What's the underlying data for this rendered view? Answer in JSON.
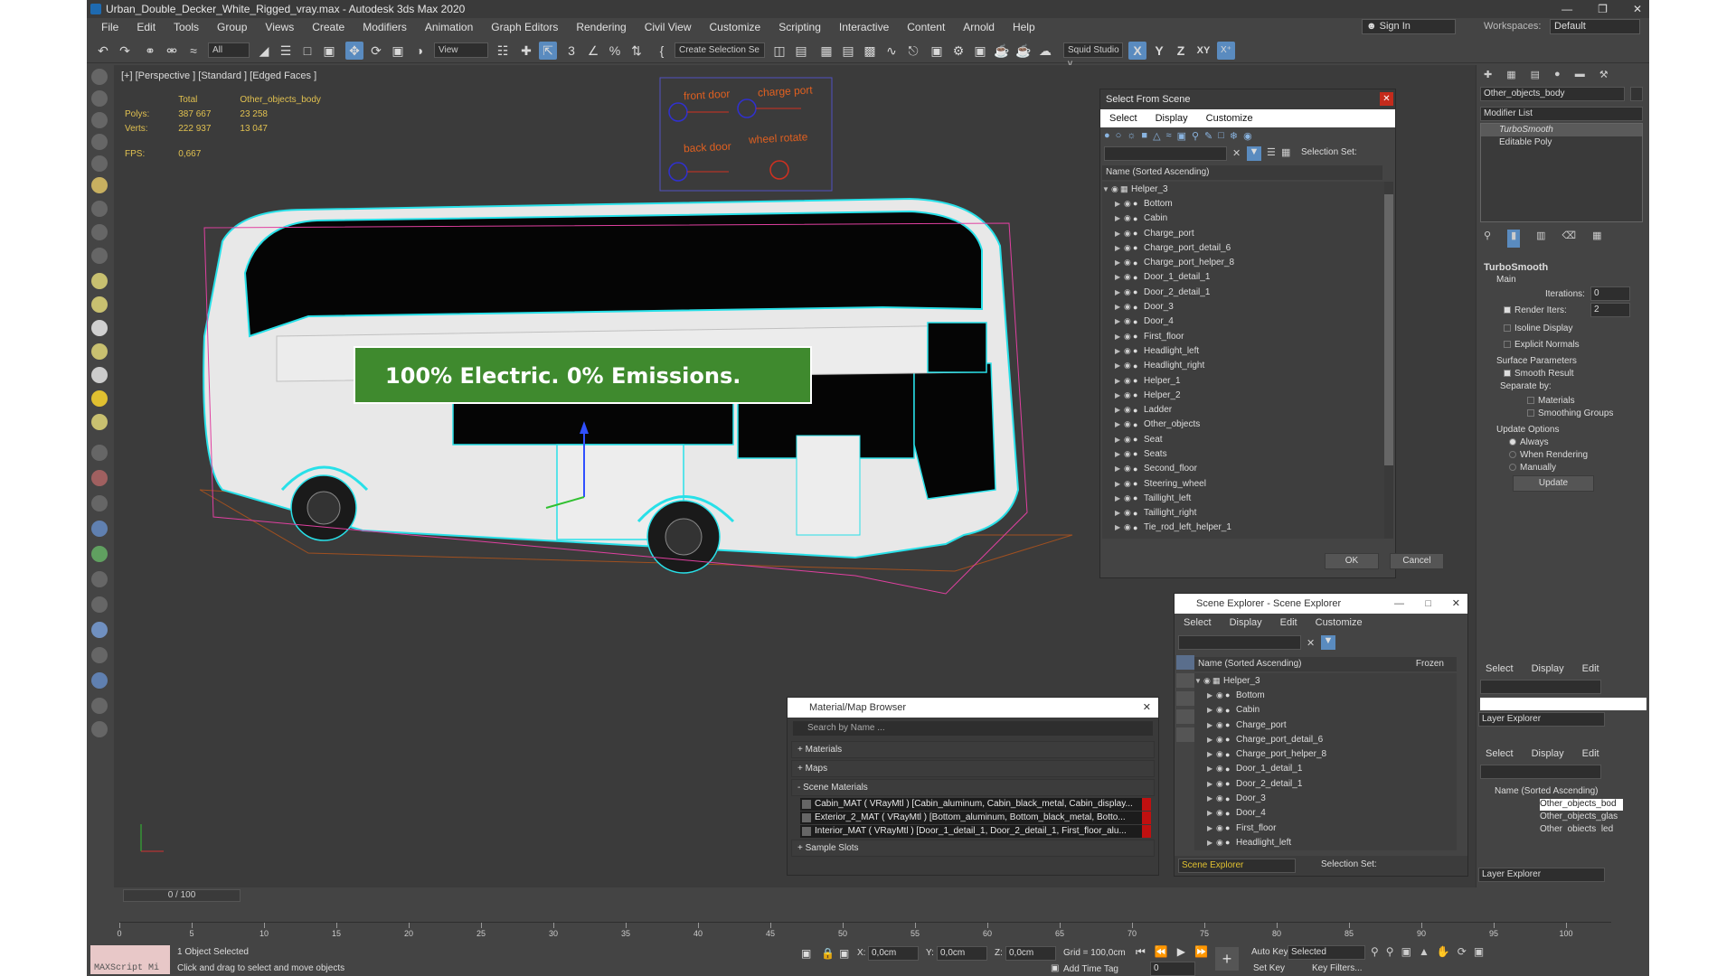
{
  "window": {
    "title": "Urban_Double_Decker_White_Rigged_vray.max - Autodesk 3ds Max 2020"
  },
  "menu": [
    "File",
    "Edit",
    "Tools",
    "Group",
    "Views",
    "Create",
    "Modifiers",
    "Animation",
    "Graph Editors",
    "Rendering",
    "Civil View",
    "Customize",
    "Scripting",
    "Interactive",
    "Content",
    "Arnold",
    "Help"
  ],
  "account": {
    "sign_in": "Sign In",
    "workspaces_label": "Workspaces:",
    "workspace": "Default"
  },
  "toolbar": {
    "filter": "All",
    "view": "View",
    "create_selection": "Create Selection Se",
    "squid": "Squid Studio v",
    "axes": [
      "X",
      "Y",
      "Z",
      "XY"
    ]
  },
  "viewport": {
    "label": "[+] [Perspective ] [Standard ] [Edged Faces ]",
    "stats": {
      "total_label": "Total",
      "object": "Other_objects_body",
      "polys_label": "Polys:",
      "polys_total": "387 667",
      "polys_obj": "23 258",
      "verts_label": "Verts:",
      "verts_total": "222 937",
      "verts_obj": "13 047",
      "fps_label": "FPS:",
      "fps": "0,667"
    },
    "rig_labels": [
      "front door",
      "charge port",
      "back door",
      "wheel rotate"
    ],
    "banner_text": "100% Electric. 0% Emissions."
  },
  "select_from_scene": {
    "title": "Select From Scene",
    "menu": [
      "Select",
      "Display",
      "Customize"
    ],
    "selection_set_label": "Selection Set:",
    "column": "Name (Sorted Ascending)",
    "root": "Helper_3",
    "items": [
      "Bottom",
      "Cabin",
      "Charge_port",
      "Charge_port_detail_6",
      "Charge_port_helper_8",
      "Door_1_detail_1",
      "Door_2_detail_1",
      "Door_3",
      "Door_4",
      "First_floor",
      "Headlight_left",
      "Headlight_right",
      "Helper_1",
      "Helper_2",
      "Ladder",
      "Other_objects",
      "Seat",
      "Seats",
      "Second_floor",
      "Steering_wheel",
      "Taillight_left",
      "Taillight_right",
      "Tie_rod_left_helper_1"
    ],
    "ok": "OK",
    "cancel": "Cancel"
  },
  "scene_explorer": {
    "title": "Scene Explorer - Scene Explorer",
    "menu": [
      "Select",
      "Display",
      "Edit",
      "Customize"
    ],
    "column": "Name (Sorted Ascending)",
    "frozen": "Frozen",
    "root": "Helper_3",
    "items": [
      "Bottom",
      "Cabin",
      "Charge_port",
      "Charge_port_detail_6",
      "Charge_port_helper_8",
      "Door_1_detail_1",
      "Door_2_detail_1",
      "Door_3",
      "Door_4",
      "First_floor",
      "Headlight_left"
    ],
    "footer_name": "Scene Explorer",
    "selection_set_label": "Selection Set:"
  },
  "material_browser": {
    "title": "Material/Map Browser",
    "search_placeholder": "Search by Name ...",
    "sections": [
      "+ Materials",
      "+ Maps",
      "- Scene Materials"
    ],
    "materials": [
      "Cabin_MAT ( VRayMtl ) [Cabin_aluminum, Cabin_black_metal, Cabin_display...",
      "Exterior_2_MAT ( VRayMtl ) [Bottom_aluminum, Bottom_black_metal, Botto...",
      "Interior_MAT ( VRayMtl ) [Door_1_detail_1, Door_2_detail_1, First_floor_alu..."
    ],
    "sample_slots": "+ Sample Slots"
  },
  "modify_panel": {
    "object_name": "Other_objects_body",
    "modifier_list": "Modifier List",
    "stack": [
      "TurboSmooth",
      "Editable Poly"
    ],
    "rollout": "TurboSmooth",
    "main": "Main",
    "iterations_label": "Iterations:",
    "iterations": "0",
    "render_iters_label": "Render Iters:",
    "render_iters": "2",
    "isoline": "Isoline Display",
    "explicit": "Explicit Normals",
    "surface": "Surface Parameters",
    "smooth": "Smooth Result",
    "separate": "Separate by:",
    "materials": "Materials",
    "smoothing": "Smoothing Groups",
    "update_options": "Update Options",
    "always": "Always",
    "when_rendering": "When Rendering",
    "manually": "Manually",
    "update": "Update"
  },
  "layer_panel": {
    "menu": [
      "Select",
      "Display",
      "Edit"
    ],
    "layer_explorer": "Layer Explorer",
    "column": "Name (Sorted Ascending)",
    "items": [
      "Other_objects_bod",
      "Other_objects_glas",
      "Other_objects_led"
    ]
  },
  "timeline": {
    "frame": "0 / 100",
    "ticks": [
      0,
      5,
      10,
      15,
      20,
      25,
      30,
      35,
      40,
      45,
      50,
      55,
      60,
      65,
      70,
      75,
      80,
      85,
      90,
      95,
      100
    ]
  },
  "status": {
    "maxscript": "MAXScript Mi",
    "selected": "1 Object Selected",
    "prompt": "Click and drag to select and move objects",
    "x_label": "X:",
    "x": "0,0cm",
    "y_label": "Y:",
    "y": "0,0cm",
    "z_label": "Z:",
    "z": "0,0cm",
    "grid": "Grid = 100,0cm",
    "add_time_tag": "Add Time Tag",
    "auto_key": "Auto Key",
    "selected_mode": "Selected",
    "set_key": "Set Key",
    "key_filters": "Key Filters...",
    "frame_field": "0"
  },
  "colors": {
    "accent": "#5a8bbf",
    "wire_cyan": "#28e0e8",
    "wire_pink": "#e040a0",
    "rig_orange": "#e06020"
  }
}
